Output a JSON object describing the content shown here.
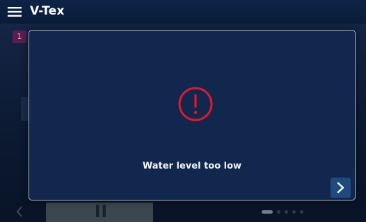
{
  "header": {
    "title": "V-Tex",
    "menu_icon": "hamburger-menu-icon"
  },
  "background": {
    "step_badge": "1",
    "back_icon": "chevron-left-icon",
    "pause_icon": "pause-icon",
    "page_dots": {
      "total": 5,
      "active": 1
    }
  },
  "dialog": {
    "icon": "exclamation-circle-icon",
    "message": "Water level too low",
    "next_icon": "chevron-right-icon"
  },
  "colors": {
    "header_bg": "#0a1b38",
    "dialog_bg": "#11274d",
    "dialog_border": "#a9b6c8",
    "alert_red": "#e0182d",
    "button_bg": "#1f4a7f"
  }
}
